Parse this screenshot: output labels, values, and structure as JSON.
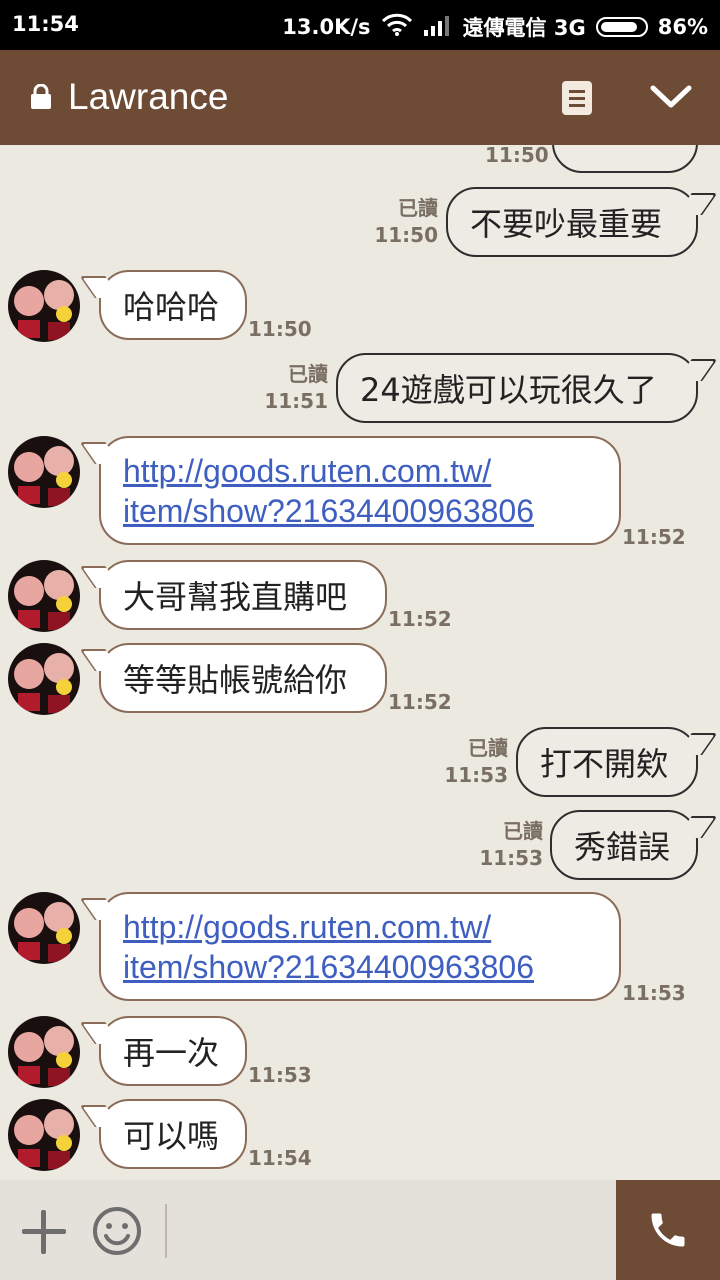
{
  "status_bar": {
    "time": "11:54",
    "speed": "13.0K/s",
    "carrier": "遠傳電信 3G",
    "battery": "86%",
    "battery_level": 0.86
  },
  "header": {
    "title": "Lawrance",
    "icons": [
      "lock-icon",
      "note-icon",
      "chevron-down-icon"
    ]
  },
  "messages": [
    {
      "dir": "out",
      "text": "不要吵最重要",
      "status": "已讀",
      "time": "11:50"
    },
    {
      "dir": "in",
      "text": "哈哈哈",
      "time": "11:50"
    },
    {
      "dir": "out",
      "text": "24遊戲可以玩很久了",
      "status": "已讀",
      "time": "11:51"
    },
    {
      "dir": "in",
      "line1": "http://goods.ruten.com.tw/",
      "line2": "item/show?21634400963806",
      "time": "11:52"
    },
    {
      "dir": "in",
      "text": "大哥幫我直購吧",
      "time": "11:52"
    },
    {
      "dir": "in",
      "text": "等等貼帳號給你",
      "time": "11:52"
    },
    {
      "dir": "out",
      "text": "打不開欸",
      "status": "已讀",
      "time": "11:53"
    },
    {
      "dir": "out",
      "text": "秀錯誤",
      "status": "已讀",
      "time": "11:53"
    },
    {
      "dir": "in",
      "line1": "http://goods.ruten.com.tw/",
      "line2": "item/show?21634400963806",
      "time": "11:53"
    },
    {
      "dir": "in",
      "text": "再一次",
      "time": "11:53"
    },
    {
      "dir": "in",
      "text": "可以嗎",
      "time": "11:54"
    }
  ],
  "partial_top": {
    "time": "11:50"
  },
  "colors": {
    "header": "#6E4B35",
    "background": "#ECE9E0",
    "link": "#3F5FC0",
    "bubble_border": "#8A6C58"
  }
}
